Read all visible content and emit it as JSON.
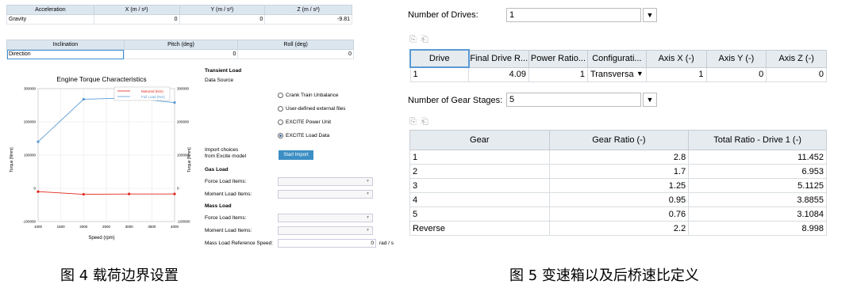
{
  "left": {
    "accel_headers": [
      "Acceleration",
      "X (m / s²)",
      "Y (m / s²)",
      "Z (m / s²)"
    ],
    "accel_row": [
      "Gravity",
      "0",
      "0",
      "-9.81"
    ],
    "incl_headers": [
      "Inclination",
      "Pitch (deg)",
      "Roll (deg)"
    ],
    "incl_row": [
      "Direction",
      "0",
      "0"
    ],
    "chart": {
      "title": "Engine Torque Characteristics",
      "legend": [
        "Motored (Nm)",
        "Full Load (Nm)"
      ],
      "xlabel": "Speed (rpm)",
      "ylabel_left": "Torque [Nmm]",
      "ylabel_right": "Torque [Nmm]",
      "yticks": [
        "300000",
        "200000",
        "100000",
        "0",
        "-100000"
      ],
      "yticks_right": [
        "300000",
        "200000",
        "100000",
        "0",
        "-100000"
      ],
      "xticks": [
        "1000",
        "1500",
        "2000",
        "2500",
        "3000",
        "3500",
        "4000"
      ]
    },
    "settings": {
      "transient_load": "Transient Load",
      "data_source": "Data Source",
      "radio_options": [
        "Crank Train Unbalance",
        "User-defined external files",
        "EXCITE Power Unit",
        "EXCITE Load Data"
      ],
      "radio_selected": 3,
      "import_label_1": "Import choices",
      "import_label_2": "from Excite model",
      "start_import": "Start Import",
      "gas_load": "Gas Load",
      "force_load_items": "Force Load Items:",
      "moment_load_items": "Moment Load Items:",
      "mass_load": "Mass Load",
      "force_load_items_2": "Force Load Items:",
      "moment_load_items_2": "Moment Load Items:",
      "mass_ref_speed": "Mass Load Reference Speed:",
      "mass_ref_value": "0",
      "mass_ref_unit": "rad / s"
    }
  },
  "chart_data": {
    "type": "line",
    "title": "Engine Torque Characteristics",
    "xlabel": "Speed (rpm)",
    "ylabel": "Torque [Nmm]",
    "xlim": [
      1000,
      4000
    ],
    "ylim": [
      -100000,
      300000
    ],
    "series": [
      {
        "name": "Full Load (Nm)",
        "color": "#5b9bd5",
        "x": [
          1000,
          2000,
          3000,
          4000
        ],
        "y": [
          140000,
          268000,
          272000,
          258000
        ]
      },
      {
        "name": "Motored (Nm)",
        "color": "#e0261b",
        "x": [
          1000,
          2000,
          3000,
          4000
        ],
        "y": [
          -10000,
          -18000,
          -17000,
          -17000
        ]
      }
    ]
  },
  "right": {
    "num_drives_label": "Number of Drives:",
    "num_drives_value": "1",
    "drives_headers": [
      "Drive",
      "Final Drive R...",
      "Power Ratio...",
      "Configurati...",
      "Axis X (-)",
      "Axis Y (-)",
      "Axis Z (-)"
    ],
    "drives_row": [
      "1",
      "4.09",
      "1",
      "Transversa",
      "1",
      "0",
      "0"
    ],
    "num_gears_label": "Number of Gear Stages:",
    "num_gears_value": "5",
    "gear_headers": [
      "Gear",
      "Gear Ratio (-)",
      "Total Ratio - Drive 1 (-)"
    ],
    "gear_rows": [
      [
        "1",
        "2.8",
        "11.452"
      ],
      [
        "2",
        "1.7",
        "6.953"
      ],
      [
        "3",
        "1.25",
        "5.1125"
      ],
      [
        "4",
        "0.95",
        "3.8855"
      ],
      [
        "5",
        "0.76",
        "3.1084"
      ],
      [
        "Reverse",
        "2.2",
        "8.998"
      ]
    ]
  },
  "captions": {
    "left": "图 4 载荷边界设置",
    "right": "图 5 变速箱以及后桥速比定义"
  }
}
